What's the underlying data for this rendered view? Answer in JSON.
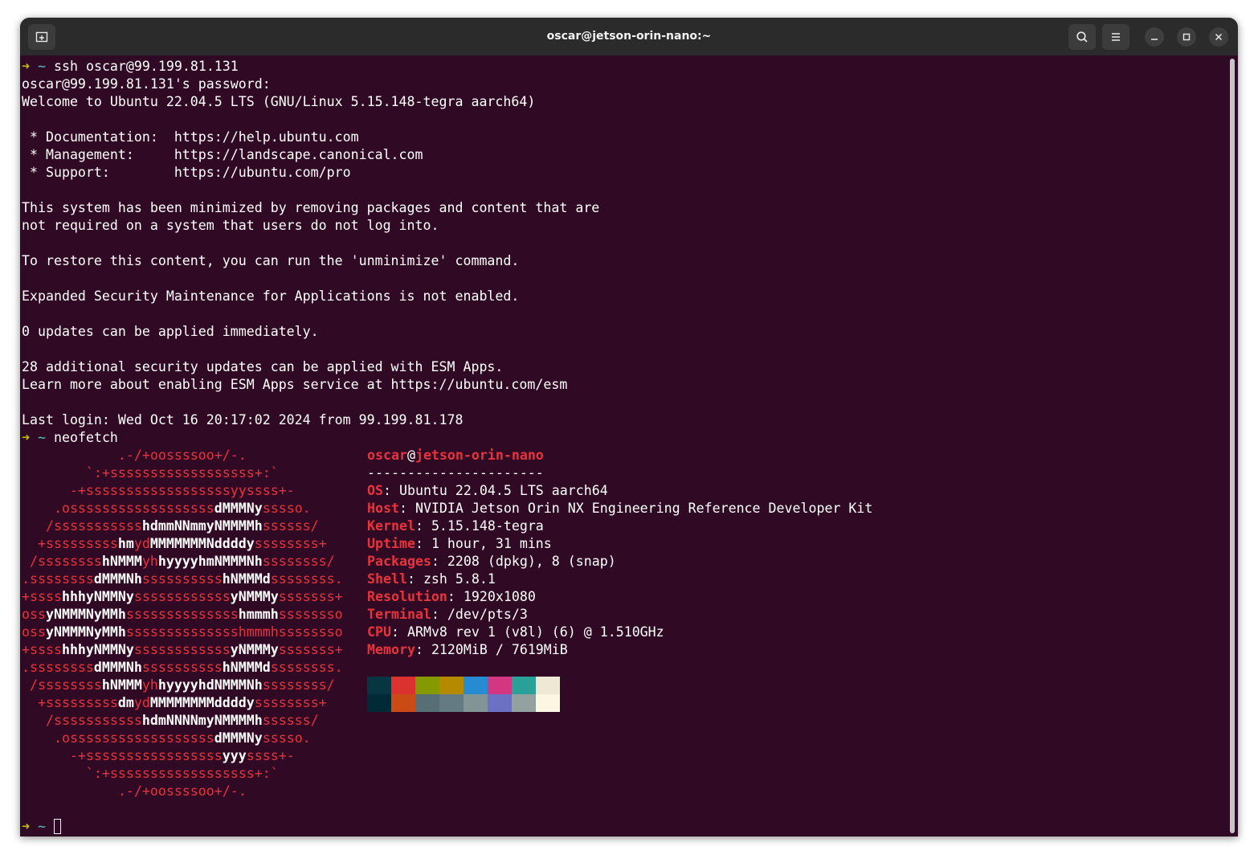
{
  "window": {
    "title": "oscar@jetson-orin-nano:~"
  },
  "icons": {
    "new_tab": "new-tab-icon",
    "search": "search-icon",
    "menu": "hamburger-menu-icon",
    "minimize": "minimize-icon",
    "maximize": "maximize-icon",
    "close": "close-icon"
  },
  "prompt": {
    "arrow": "➜",
    "dir": "~"
  },
  "lines": [
    {
      "kind": "cmd",
      "text": "ssh oscar@99.199.81.131"
    },
    {
      "kind": "out",
      "text": "oscar@99.199.81.131's password:"
    },
    {
      "kind": "out",
      "text": "Welcome to Ubuntu 22.04.5 LTS (GNU/Linux 5.15.148-tegra aarch64)"
    },
    {
      "kind": "out",
      "text": ""
    },
    {
      "kind": "out",
      "text": " * Documentation:  https://help.ubuntu.com"
    },
    {
      "kind": "out",
      "text": " * Management:     https://landscape.canonical.com"
    },
    {
      "kind": "out",
      "text": " * Support:        https://ubuntu.com/pro"
    },
    {
      "kind": "out",
      "text": ""
    },
    {
      "kind": "out",
      "text": "This system has been minimized by removing packages and content that are"
    },
    {
      "kind": "out",
      "text": "not required on a system that users do not log into."
    },
    {
      "kind": "out",
      "text": ""
    },
    {
      "kind": "out",
      "text": "To restore this content, you can run the 'unminimize' command."
    },
    {
      "kind": "out",
      "text": ""
    },
    {
      "kind": "out",
      "text": "Expanded Security Maintenance for Applications is not enabled."
    },
    {
      "kind": "out",
      "text": ""
    },
    {
      "kind": "out",
      "text": "0 updates can be applied immediately."
    },
    {
      "kind": "out",
      "text": ""
    },
    {
      "kind": "out",
      "text": "28 additional security updates can be applied with ESM Apps."
    },
    {
      "kind": "out",
      "text": "Learn more about enabling ESM Apps service at https://ubuntu.com/esm"
    },
    {
      "kind": "out",
      "text": ""
    },
    {
      "kind": "out",
      "text": "Last login: Wed Oct 16 20:17:02 2024 from 99.199.81.178"
    },
    {
      "kind": "cmd",
      "text": "neofetch"
    }
  ],
  "ascii_logo": [
    [
      [
        "r",
        "            .-/+oossssoo+/-."
      ]
    ],
    [
      [
        "r",
        "        `:+ssssssssssssssssss+:`"
      ]
    ],
    [
      [
        "r",
        "      -+ssssssssssssssssssyyssss+-"
      ]
    ],
    [
      [
        "r",
        "    .ossssssssssssssssss"
      ],
      [
        "w",
        "dMMMNy"
      ],
      [
        "r",
        "sssso."
      ]
    ],
    [
      [
        "r",
        "   /sssssssssss"
      ],
      [
        "w",
        "hdmmNNmmyNMMMMh"
      ],
      [
        "r",
        "ssssss/"
      ]
    ],
    [
      [
        "r",
        "  +sssssssss"
      ],
      [
        "w",
        "hm"
      ],
      [
        "r",
        "yd"
      ],
      [
        "w",
        "MMMMMMMNddddy"
      ],
      [
        "r",
        "ssssssss+"
      ]
    ],
    [
      [
        "r",
        " /ssssssss"
      ],
      [
        "w",
        "hNMMM"
      ],
      [
        "r",
        "yh"
      ],
      [
        "w",
        "hyyyyhmNMMMNh"
      ],
      [
        "r",
        "ssssssss/"
      ]
    ],
    [
      [
        "r",
        ".ssssssss"
      ],
      [
        "w",
        "dMMMNh"
      ],
      [
        "r",
        "ssssssssss"
      ],
      [
        "w",
        "hNMMMd"
      ],
      [
        "r",
        "ssssssss."
      ]
    ],
    [
      [
        "r",
        "+ssss"
      ],
      [
        "w",
        "hhhyNMMNy"
      ],
      [
        "r",
        "ssssssssssss"
      ],
      [
        "w",
        "yNMMMy"
      ],
      [
        "r",
        "sssssss+"
      ]
    ],
    [
      [
        "r",
        "oss"
      ],
      [
        "w",
        "yNMMMNyMMh"
      ],
      [
        "r",
        "ssssssssssssss"
      ],
      [
        "w",
        "hmmmh"
      ],
      [
        "r",
        "ssssssso"
      ]
    ],
    [
      [
        "r",
        "oss"
      ],
      [
        "w",
        "yNMMMNyMMh"
      ],
      [
        "r",
        "sssssssssssssshmmmhssssssso"
      ]
    ],
    [
      [
        "r",
        "+ssss"
      ],
      [
        "w",
        "hhhyNMMNy"
      ],
      [
        "r",
        "ssssssssssss"
      ],
      [
        "w",
        "yNMMMy"
      ],
      [
        "r",
        "sssssss+"
      ]
    ],
    [
      [
        "r",
        ".ssssssss"
      ],
      [
        "w",
        "dMMMNh"
      ],
      [
        "r",
        "ssssssssss"
      ],
      [
        "w",
        "hNMMMd"
      ],
      [
        "r",
        "ssssssss."
      ]
    ],
    [
      [
        "r",
        " /ssssssss"
      ],
      [
        "w",
        "hNMMM"
      ],
      [
        "r",
        "yh"
      ],
      [
        "w",
        "hyyyyhdNMMMNh"
      ],
      [
        "r",
        "ssssssss/"
      ]
    ],
    [
      [
        "r",
        "  +sssssssss"
      ],
      [
        "w",
        "dm"
      ],
      [
        "r",
        "yd"
      ],
      [
        "w",
        "MMMMMMMMddddy"
      ],
      [
        "r",
        "ssssssss+"
      ]
    ],
    [
      [
        "r",
        "   /sssssssssss"
      ],
      [
        "w",
        "hdmNNNNmyNMMMMh"
      ],
      [
        "r",
        "ssssss/"
      ]
    ],
    [
      [
        "r",
        "    .ossssssssssssssssss"
      ],
      [
        "w",
        "dMMMNy"
      ],
      [
        "r",
        "sssso."
      ]
    ],
    [
      [
        "r",
        "      -+sssssssssssssssss"
      ],
      [
        "w",
        "yyy"
      ],
      [
        "r",
        "ssss+-"
      ]
    ],
    [
      [
        "r",
        "        `:+ssssssssssssssssss+:`"
      ]
    ],
    [
      [
        "r",
        "            .-/+oossssoo+/-."
      ]
    ]
  ],
  "neofetch": {
    "user": "oscar",
    "at": "@",
    "host": "jetson-orin-nano",
    "separator": "----------------------",
    "fields": [
      {
        "key": "OS",
        "value": "Ubuntu 22.04.5 LTS aarch64"
      },
      {
        "key": "Host",
        "value": "NVIDIA Jetson Orin NX Engineering Reference Developer Kit"
      },
      {
        "key": "Kernel",
        "value": "5.15.148-tegra"
      },
      {
        "key": "Uptime",
        "value": "1 hour, 31 mins"
      },
      {
        "key": "Packages",
        "value": "2208 (dpkg), 8 (snap)"
      },
      {
        "key": "Shell",
        "value": "zsh 5.8.1"
      },
      {
        "key": "Resolution",
        "value": "1920x1080"
      },
      {
        "key": "Terminal",
        "value": "/dev/pts/3"
      },
      {
        "key": "CPU",
        "value": "ARMv8 rev 1 (v8l) (6) @ 1.510GHz"
      },
      {
        "key": "Memory",
        "value": "2120MiB / 7619MiB"
      }
    ],
    "palette_top": [
      "#073642",
      "#dc322f",
      "#859900",
      "#b58900",
      "#268bd2",
      "#d33682",
      "#2aa198",
      "#eee8d5"
    ],
    "palette_bottom": [
      "#002b36",
      "#cb4b16",
      "#586e75",
      "#657b83",
      "#839496",
      "#6c71c4",
      "#93a1a1",
      "#fdf6e3"
    ]
  },
  "colors": {
    "background": "#300a24",
    "titlebar": "#2b2b2b",
    "prompt_arrow": "#c4c000",
    "prompt_dir": "#59c2c6",
    "accent_red": "#e9333c"
  }
}
